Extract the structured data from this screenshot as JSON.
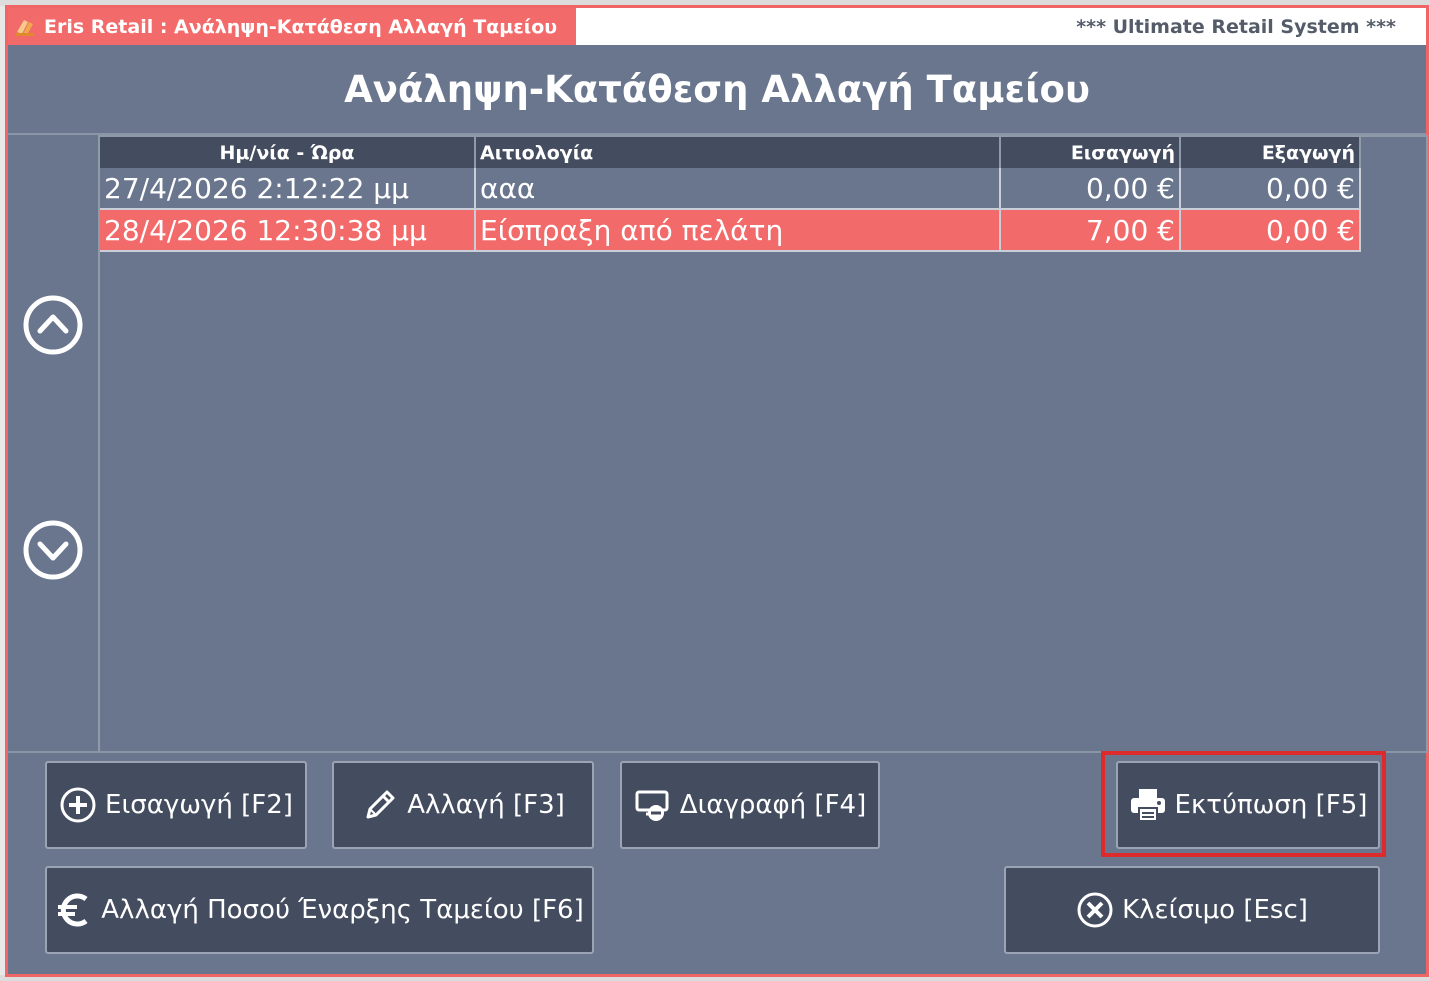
{
  "window": {
    "title": "Eris Retail : Ανάληψη-Κατάθεση Αλλαγή Ταμείου",
    "tagline": "*** Ultimate Retail System ***",
    "header": "Ανάληψη-Κατάθεση Αλλαγή Ταμείου"
  },
  "grid": {
    "columns": [
      "Ημ/νία - Ώρα",
      "Αιτιολογία",
      "Εισαγωγή",
      "Εξαγωγή"
    ],
    "rows": [
      {
        "datetime": "27/4/2026 2:12:22 μμ",
        "reason": "ααα",
        "in": "0,00 €",
        "out": "0,00 €",
        "selected": false
      },
      {
        "datetime": "28/4/2026 12:30:38 μμ",
        "reason": "Είσπραξη από πελάτη",
        "in": "7,00 €",
        "out": "0,00 €",
        "selected": true
      }
    ]
  },
  "buttons": {
    "insert": "Εισαγωγή [F2]",
    "edit": "Αλλαγή [F3]",
    "delete": "Διαγραφή [F4]",
    "print": "Εκτύπωση [F5]",
    "change_opening": "Αλλαγή Ποσού Έναρξης Ταμείου [F6]",
    "close": "Κλείσιμο [Esc]"
  },
  "icons": {
    "up": "chevron-up-circle-icon",
    "down": "chevron-down-circle-icon",
    "insert": "plus-circle-icon",
    "edit": "pencil-icon",
    "delete": "remove-screen-icon",
    "print": "printer-icon",
    "change_opening": "euro-icon",
    "close": "x-circle-icon"
  },
  "colors": {
    "accent": "#f26a6a",
    "panel": "#69768e",
    "header_dark": "#444c5f",
    "highlight_box": "#dd2b2b"
  }
}
